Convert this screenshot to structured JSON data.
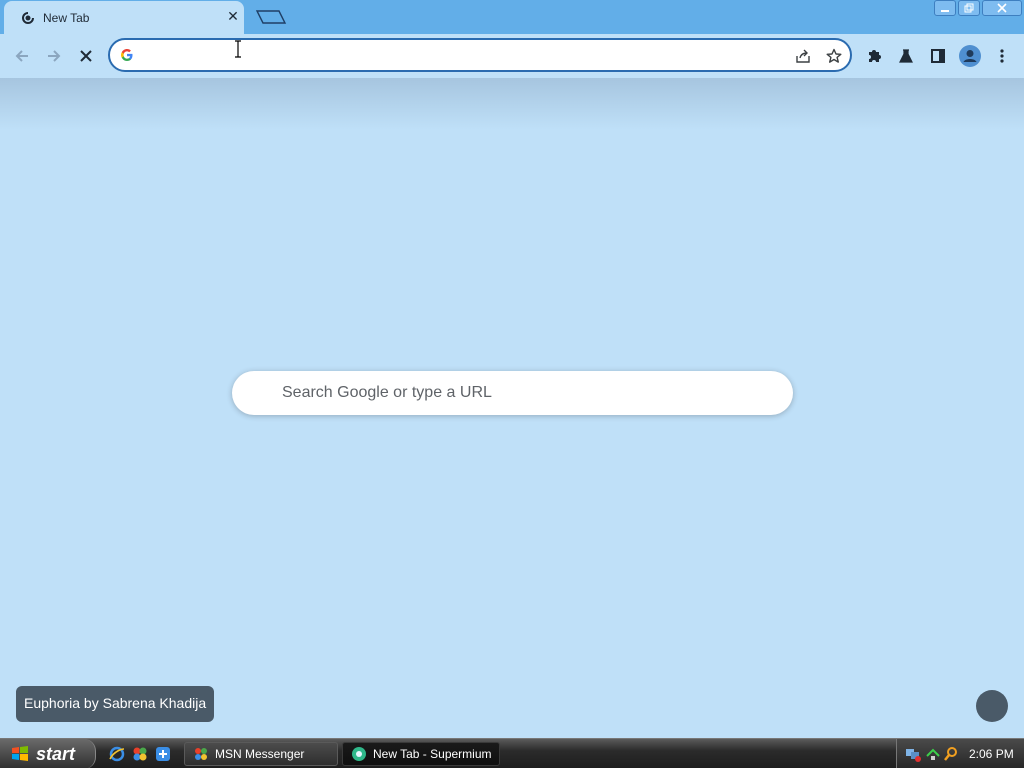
{
  "browser": {
    "tab": {
      "title": "New Tab",
      "close_label": "✕"
    },
    "omnibox": {
      "value": "",
      "placeholder": ""
    }
  },
  "ntp": {
    "search_placeholder": "Search Google or type a URL",
    "attribution": "Euphoria by Sabrena Khadija"
  },
  "taskbar": {
    "start_label": "start",
    "tasks": [
      {
        "label": "MSN Messenger"
      },
      {
        "label": "New Tab - Supermium"
      }
    ],
    "clock": "2:06 PM"
  },
  "icons": {
    "tab_favicon": "loading-throbber-icon",
    "back": "back-arrow-icon",
    "forward": "forward-arrow-icon",
    "stop": "stop-x-icon",
    "share": "share-icon",
    "bookmark": "star-icon",
    "extensions": "puzzle-icon",
    "labs": "flask-icon",
    "side_panel": "side-panel-icon",
    "profile": "profile-avatar-icon",
    "menu": "kebab-menu-icon"
  },
  "colors": {
    "tab_strip": "#62aee8",
    "page_bg": "#bfe0f8",
    "omnibox_border": "#2a6bb0",
    "attribution_bg": "#4a5a68"
  }
}
